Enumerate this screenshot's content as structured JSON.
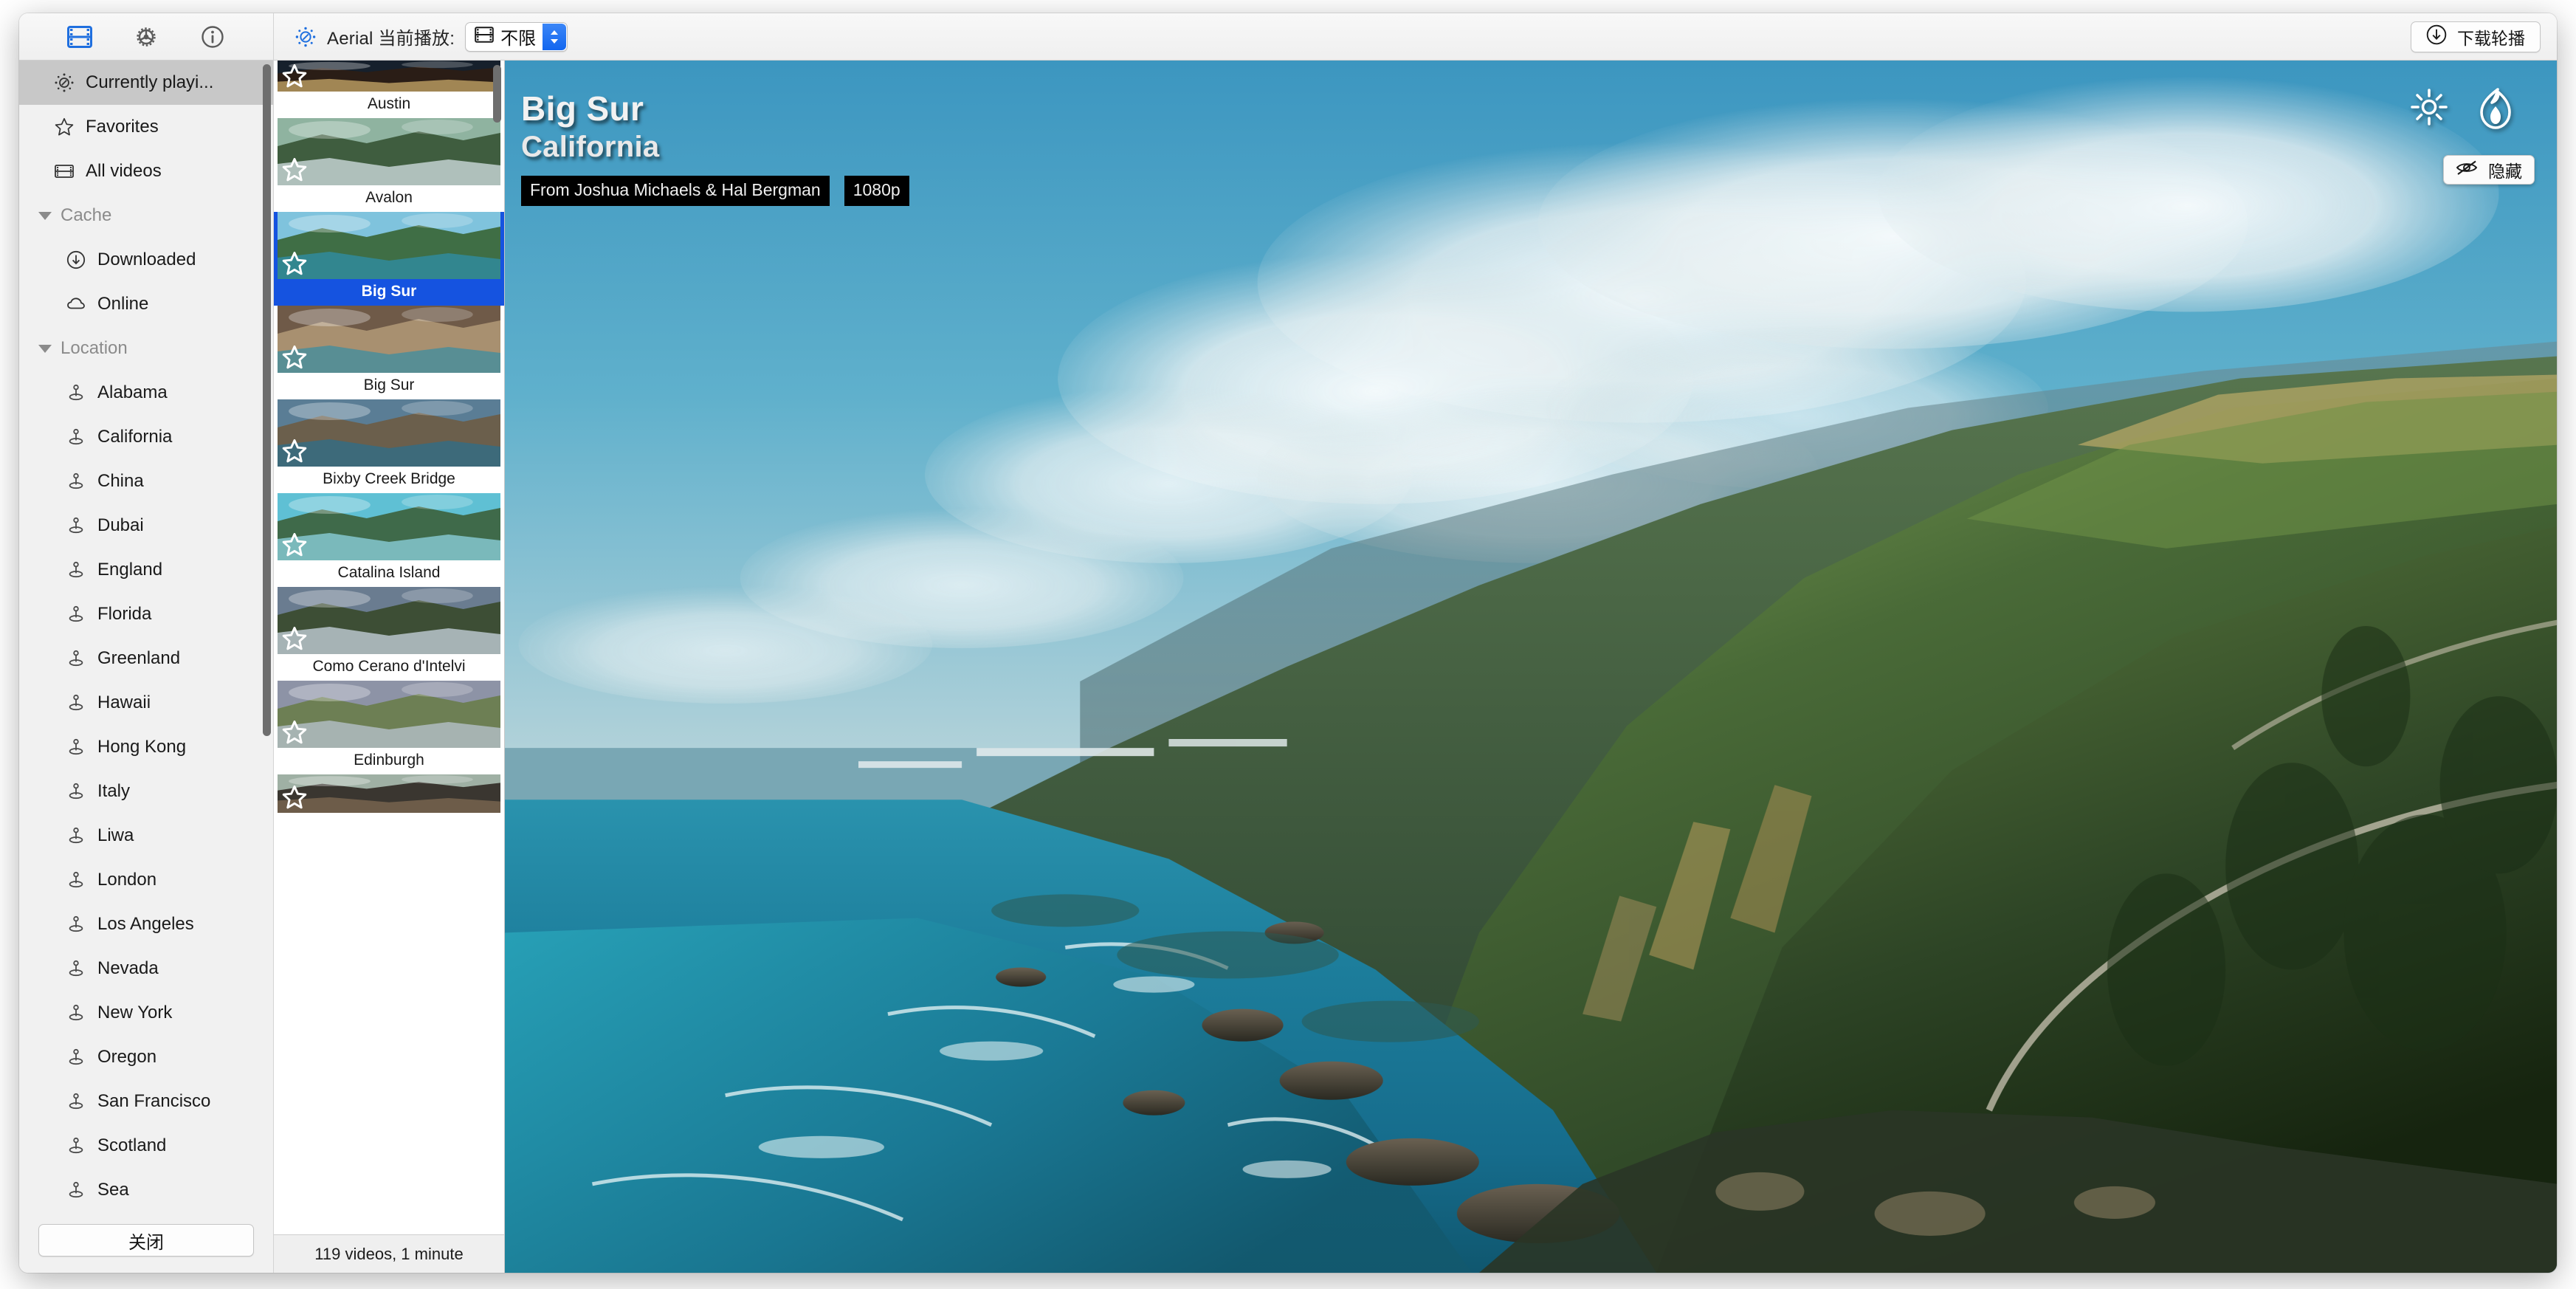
{
  "toolbar": {
    "icons": [
      {
        "name": "videos-tab-icon",
        "glyph": "film-strip",
        "active": true
      },
      {
        "name": "settings-tab-icon",
        "glyph": "gear",
        "active": false
      },
      {
        "name": "info-tab-icon",
        "glyph": "info-circle",
        "active": false
      }
    ],
    "aerial_label": "Aerial 当前播放:",
    "quality_value": "不限",
    "quality_icon": "film-strip-icon",
    "download_label": "下载轮播",
    "download_icon": "download-circle-icon"
  },
  "sidebar": {
    "scrollbar_visible": true,
    "items": [
      {
        "label": "Currently playi...",
        "icon": "aerial-icon",
        "type": "row",
        "selected": true
      },
      {
        "label": "Favorites",
        "icon": "star-icon",
        "type": "row",
        "selected": false
      },
      {
        "label": "All videos",
        "icon": "film-strip-icon",
        "type": "row",
        "selected": false
      },
      {
        "label": "Cache",
        "icon": "disclosure-triangle-icon",
        "type": "group"
      },
      {
        "label": "Downloaded",
        "icon": "download-circle-icon",
        "type": "child"
      },
      {
        "label": "Online",
        "icon": "cloud-icon",
        "type": "child"
      },
      {
        "label": "Location",
        "icon": "disclosure-triangle-icon",
        "type": "group"
      },
      {
        "label": "Alabama",
        "icon": "map-pin-icon",
        "type": "child"
      },
      {
        "label": "California",
        "icon": "map-pin-icon",
        "type": "child"
      },
      {
        "label": "China",
        "icon": "map-pin-icon",
        "type": "child"
      },
      {
        "label": "Dubai",
        "icon": "map-pin-icon",
        "type": "child"
      },
      {
        "label": "England",
        "icon": "map-pin-icon",
        "type": "child"
      },
      {
        "label": "Florida",
        "icon": "map-pin-icon",
        "type": "child"
      },
      {
        "label": "Greenland",
        "icon": "map-pin-icon",
        "type": "child"
      },
      {
        "label": "Hawaii",
        "icon": "map-pin-icon",
        "type": "child"
      },
      {
        "label": "Hong Kong",
        "icon": "map-pin-icon",
        "type": "child"
      },
      {
        "label": "Italy",
        "icon": "map-pin-icon",
        "type": "child"
      },
      {
        "label": "Liwa",
        "icon": "map-pin-icon",
        "type": "child"
      },
      {
        "label": "London",
        "icon": "map-pin-icon",
        "type": "child"
      },
      {
        "label": "Los Angeles",
        "icon": "map-pin-icon",
        "type": "child"
      },
      {
        "label": "Nevada",
        "icon": "map-pin-icon",
        "type": "child"
      },
      {
        "label": "New York",
        "icon": "map-pin-icon",
        "type": "child"
      },
      {
        "label": "Oregon",
        "icon": "map-pin-icon",
        "type": "child"
      },
      {
        "label": "San Francisco",
        "icon": "map-pin-icon",
        "type": "child"
      },
      {
        "label": "Scotland",
        "icon": "map-pin-icon",
        "type": "child"
      },
      {
        "label": "Sea",
        "icon": "map-pin-icon",
        "type": "child"
      }
    ],
    "close_label": "关闭"
  },
  "thumbnails": {
    "status": "119 videos, 1 minute",
    "items": [
      {
        "label": "Austin",
        "selected": false,
        "partial_top": true,
        "scene": "austin"
      },
      {
        "label": "Avalon",
        "selected": false,
        "scene": "avalon"
      },
      {
        "label": "Big Sur",
        "selected": true,
        "scene": "bigsur1"
      },
      {
        "label": "Big Sur",
        "selected": false,
        "scene": "bigsur2"
      },
      {
        "label": "Bixby Creek Bridge",
        "selected": false,
        "scene": "bixby"
      },
      {
        "label": "Catalina Island",
        "selected": false,
        "scene": "catalina"
      },
      {
        "label": "Como Cerano d'Intelvi",
        "selected": false,
        "scene": "como"
      },
      {
        "label": "Edinburgh",
        "selected": false,
        "scene": "edinburgh"
      },
      {
        "label": "",
        "selected": false,
        "partial_bottom": true,
        "scene": "vegas"
      }
    ]
  },
  "preview": {
    "title": "Big Sur",
    "subtitle": "California",
    "credit": "From Joshua Michaels & Hal Bergman",
    "resolution": "1080p",
    "hide_label": "隐藏",
    "hide_icon": "eye-slash-icon",
    "time_icon": "sun-icon",
    "weather_icon": "flame-drop-icon"
  },
  "colors": {
    "accent": "#1553e0",
    "toolbar_active": "#1f6fdf",
    "sidebar_selected": "#c8c8c8",
    "sky_top": "#3f9dc4",
    "sky_bottom": "#bfd8dd",
    "ocean": "#1f7fa0",
    "hill_green": "#3e5b36"
  }
}
